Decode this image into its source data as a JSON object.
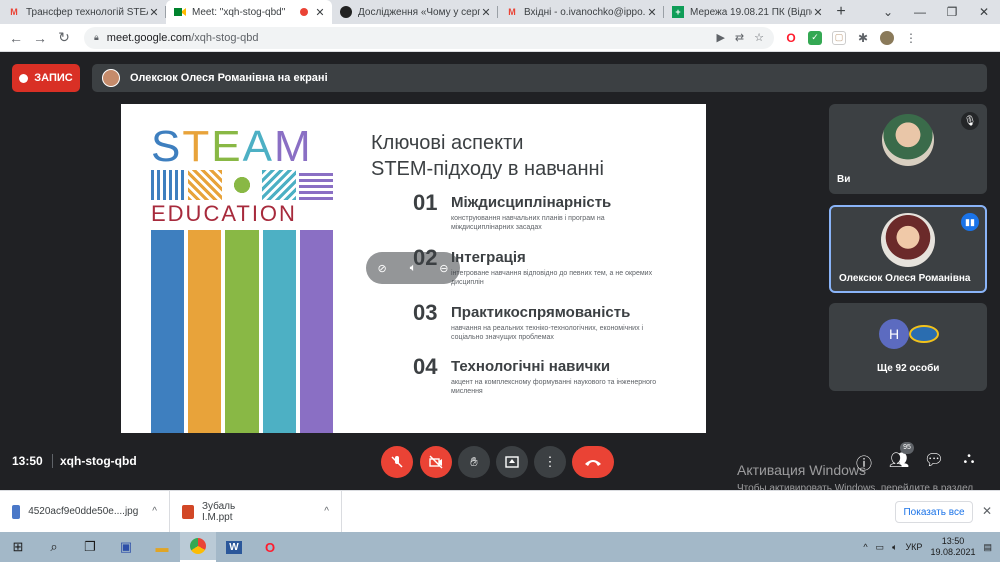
{
  "browser": {
    "tabs": [
      {
        "title": "Трансфер технологій STEAM",
        "favicon": "gmail",
        "active": false
      },
      {
        "title": "Meet: \"xqh-stog-qbd\"",
        "favicon": "meet",
        "active": true
      },
      {
        "title": "Дослідження «Чому у серпн",
        "favicon": "dark",
        "active": false
      },
      {
        "title": "Вхідні - o.ivanochko@ippo.e",
        "favicon": "gmail",
        "active": false
      },
      {
        "title": "Мережа 19.08.21 ПК (Відпо",
        "favicon": "sheets",
        "active": false
      }
    ],
    "url": "meet.google.com/xqh-stog-qbd",
    "url_host": "meet.google.com",
    "url_path": "/xqh-stog-qbd"
  },
  "meet": {
    "record_label": "ЗАПИС",
    "presenting_label": "Олексюк Олеся Романівна на екрані",
    "time": "13:50",
    "meeting_code": "xqh-stog-qbd",
    "participants_count": "95",
    "tiles": [
      {
        "name": "Ви"
      },
      {
        "name": "Олексюк Олеся Романівна"
      },
      {
        "name": "Ще 92 особи",
        "initial": "Н"
      }
    ]
  },
  "slide": {
    "logo_letters": [
      "S",
      "T",
      "E",
      "A",
      "M"
    ],
    "logo_colors": [
      "#3e7fbf",
      "#e8a33a",
      "#89b845",
      "#4db0c4",
      "#8a6fc4"
    ],
    "logo_subtitle": "EDUCATION",
    "heading_line1": "Ключові аспекти",
    "heading_line2": "STEM-підходу в навчанні",
    "items": [
      {
        "num": "01",
        "title": "Міждисциплінарність",
        "desc": "конструювання навчальних планів і програм на міждисциплінарних засадах"
      },
      {
        "num": "02",
        "title": "Інтеграція",
        "desc": "інтегроване навчання відповідно до певних тем, а не окремих дисциплін"
      },
      {
        "num": "03",
        "title": "Практикоспрямованість",
        "desc": "навчання на реальних техніко-технологічних, економічних і соціально значущих проблемах"
      },
      {
        "num": "04",
        "title": "Технологічні навички",
        "desc": "акцент на комплексному формуванні наукового та інженерного мислення"
      }
    ]
  },
  "watermark": {
    "line1": "Активация Windows",
    "line2": "Чтобы активировать Windows, перейдите в раздел \"Параметры\"."
  },
  "downloads": {
    "items": [
      {
        "name": "4520acf9e0dde50e....jpg"
      },
      {
        "name": "Зубаль І.М.ppt"
      }
    ],
    "show_all": "Показать все"
  },
  "taskbar": {
    "lang": "УКР",
    "time": "13:50",
    "date": "19.08.2021"
  }
}
